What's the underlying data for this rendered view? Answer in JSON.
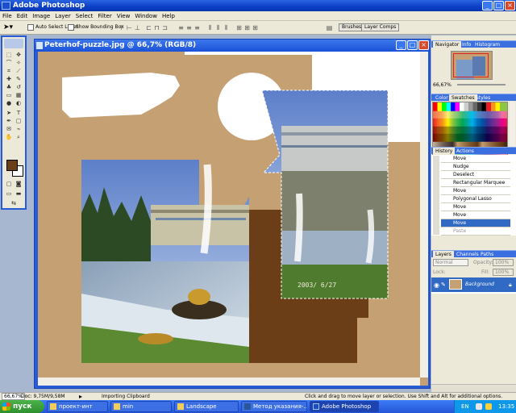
{
  "app": {
    "title": "Adobe Photoshop"
  },
  "window_buttons": {
    "minimize": "_",
    "maximize": "□",
    "close": "×"
  },
  "menu": [
    "File",
    "Edit",
    "Image",
    "Layer",
    "Select",
    "Filter",
    "View",
    "Window",
    "Help"
  ],
  "options": {
    "auto_select_label": "Auto Select Layer",
    "bounding_box_label": "Show Bounding Box",
    "palette_tabs": [
      "Brushes",
      "Layer Comps"
    ]
  },
  "document": {
    "title": "Peterhof-puzzle.jpg @ 66,7% (RGB/8)",
    "photo_date": "2003/ 6/27"
  },
  "panels": {
    "navigator": {
      "tabs": [
        "Navigator",
        "Info",
        "Histogram"
      ],
      "zoom": "66,67%"
    },
    "swatches": {
      "tabs": [
        "Color",
        "Swatches",
        "Styles"
      ]
    },
    "history": {
      "tabs": [
        "History",
        "Actions"
      ],
      "items": [
        {
          "label": "Move",
          "selected": false,
          "greyed": false
        },
        {
          "label": "Nudge",
          "selected": false,
          "greyed": false
        },
        {
          "label": "Deselect",
          "selected": false,
          "greyed": false
        },
        {
          "label": "Rectangular Marquee",
          "selected": false,
          "greyed": false
        },
        {
          "label": "Move",
          "selected": false,
          "greyed": false
        },
        {
          "label": "Polygonal Lasso",
          "selected": false,
          "greyed": false
        },
        {
          "label": "Move",
          "selected": false,
          "greyed": false
        },
        {
          "label": "Move",
          "selected": false,
          "greyed": false
        },
        {
          "label": "Move",
          "selected": true,
          "greyed": false
        },
        {
          "label": "Paste",
          "selected": false,
          "greyed": true
        }
      ]
    },
    "layers": {
      "tabs": [
        "Layers",
        "Channels",
        "Paths"
      ],
      "blend_mode": "Normal",
      "opacity_label": "Opacity:",
      "opacity": "100%",
      "fill_label": "Fill:",
      "fill": "100%",
      "lock_label": "Lock:",
      "layer_name": "Background"
    }
  },
  "status": {
    "zoom": "66,67%",
    "doc": "Doc: 9,75M/9,58M",
    "message": "Importing Clipboard",
    "hint": "Click and drag to move layer or selection.  Use Shift and Alt for additional options."
  },
  "taskbar": {
    "start": "пуск",
    "buttons": [
      {
        "label": "проект-инт",
        "active": false
      },
      {
        "label": "min",
        "active": false
      },
      {
        "label": "Landscape",
        "active": false
      },
      {
        "label": "Метод указания-...",
        "active": false
      },
      {
        "label": "Adobe Photoshop",
        "active": true
      }
    ],
    "lang": "EN",
    "clock": "13:35"
  },
  "colors": {
    "canvas_tan": "#c4a073",
    "brown_shape": "#6b3e17",
    "selection": "#316ac5"
  }
}
